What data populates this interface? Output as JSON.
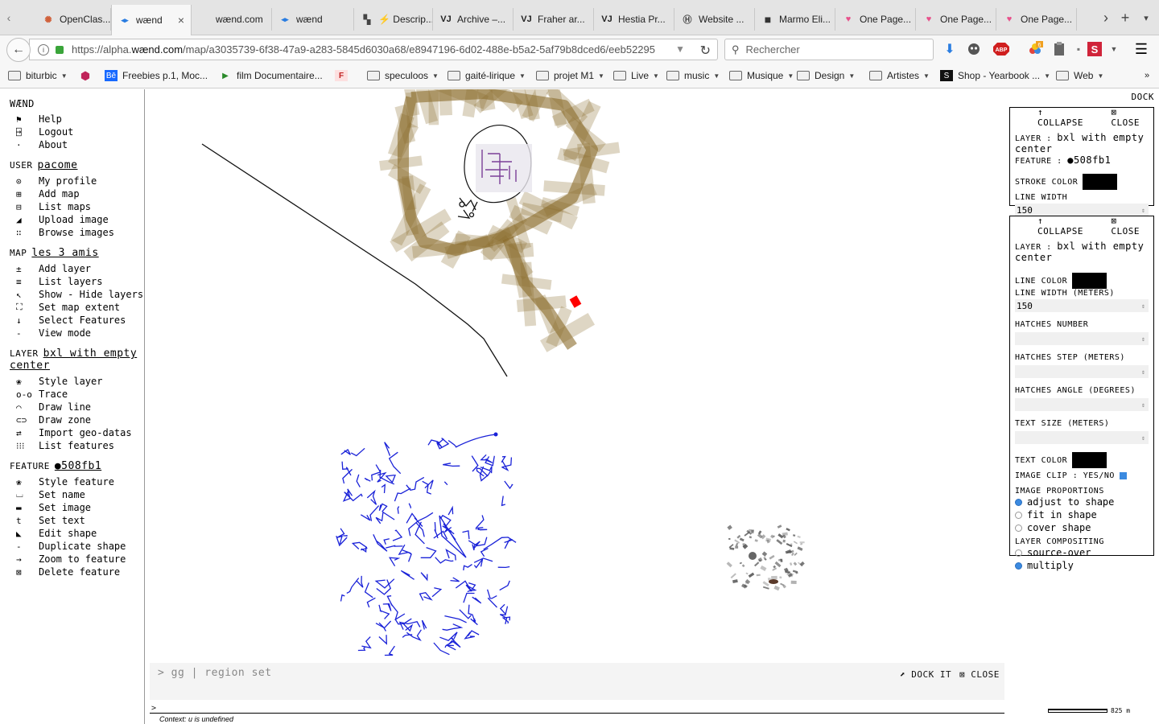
{
  "browser": {
    "tabs": [
      {
        "title": "OpenClas...",
        "icon": "openclassrooms-icon",
        "active": false
      },
      {
        "title": "wænd",
        "icon": "waend-icon",
        "active": true
      },
      {
        "title": "wænd.com",
        "icon": "",
        "active": false
      },
      {
        "title": "wænd",
        "icon": "waend-icon",
        "active": false
      },
      {
        "title": "⚡ Descrip...",
        "icon": "page-icon",
        "active": false
      },
      {
        "title": "Archive –...",
        "icon": "vj-icon",
        "active": false
      },
      {
        "title": "Fraher ar...",
        "icon": "vj-icon",
        "active": false
      },
      {
        "title": "Hestia Pr...",
        "icon": "vj-icon",
        "active": false
      },
      {
        "title": "Website ...",
        "icon": "website-icon",
        "active": false
      },
      {
        "title": "Marmo Eli...",
        "icon": "dark-square-icon",
        "active": false
      },
      {
        "title": "One Page...",
        "icon": "heart-icon",
        "active": false
      },
      {
        "title": "One Page...",
        "icon": "heart-icon",
        "active": false
      },
      {
        "title": "One Page...",
        "icon": "heart-icon",
        "active": false
      }
    ],
    "url_prefix": "https://alpha.",
    "url_domain": "wænd.com",
    "url_rest": "/map/a3035739-6f38-47a9-a283-5845d6030a68/e8947196-6d02-488e-b5a2-5af79b8dced6/eeb52295",
    "search_placeholder": "Rechercher",
    "addon_badge": "6",
    "bookmarks": [
      {
        "label": "biturbic",
        "kind": "folder"
      },
      {
        "label": "",
        "kind": "icon"
      },
      {
        "label": "Freebies p.1, Moc...",
        "kind": "behance"
      },
      {
        "label": "film Documentaire...",
        "kind": "play"
      },
      {
        "label": "",
        "kind": "f"
      },
      {
        "label": "speculoos",
        "kind": "folder"
      },
      {
        "label": "gaité-lirique",
        "kind": "folder"
      },
      {
        "label": "projet M1",
        "kind": "folder"
      },
      {
        "label": "Live",
        "kind": "folder"
      },
      {
        "label": "music",
        "kind": "folder"
      },
      {
        "label": "Musique",
        "kind": "folder"
      },
      {
        "label": "Design",
        "kind": "folder"
      },
      {
        "label": "Artistes",
        "kind": "folder"
      },
      {
        "label": "Shop - Yearbook ...",
        "kind": "shop"
      },
      {
        "label": "Web",
        "kind": "folder"
      }
    ]
  },
  "sidebar": {
    "app_name": "WÆND",
    "app_items": [
      {
        "icon": "⚑",
        "label": "Help"
      },
      {
        "icon": "⍈",
        "label": "Logout"
      },
      {
        "icon": "·",
        "label": "About"
      }
    ],
    "user_label": "USER",
    "user_name": "pacome",
    "user_items": [
      {
        "icon": "⊙",
        "label": "My profile"
      },
      {
        "icon": "⊞",
        "label": "Add map"
      },
      {
        "icon": "⊟",
        "label": "List maps"
      },
      {
        "icon": "◢",
        "label": "Upload image"
      },
      {
        "icon": "∷",
        "label": "Browse images"
      }
    ],
    "map_label": "MAP",
    "map_name": "les 3 amis",
    "map_items": [
      {
        "icon": "±",
        "label": "Add layer"
      },
      {
        "icon": "≡",
        "label": "List layers"
      },
      {
        "icon": "↖",
        "label": "Show - Hide layers"
      },
      {
        "icon": "⛶",
        "label": "Set map extent"
      },
      {
        "icon": "↓",
        "label": "Select Features"
      },
      {
        "icon": "-",
        "label": "View mode"
      }
    ],
    "layer_label": "LAYER",
    "layer_name_1": "bxl with empty",
    "layer_name_2": "center",
    "layer_items": [
      {
        "icon": "❀",
        "label": "Style layer"
      },
      {
        "icon": "o-o",
        "label": "Trace"
      },
      {
        "icon": "⌒",
        "label": "Draw line"
      },
      {
        "icon": "⊂⊃",
        "label": "Draw zone"
      },
      {
        "icon": "⇄",
        "label": "Import geo-datas"
      },
      {
        "icon": "⁝⁝⁝",
        "label": "List features"
      }
    ],
    "feature_label": "FEATURE",
    "feature_name": "●508fb1",
    "feature_items": [
      {
        "icon": "❀",
        "label": "Style feature"
      },
      {
        "icon": "⌴",
        "label": "Set name"
      },
      {
        "icon": "▬",
        "label": "Set image"
      },
      {
        "icon": "t",
        "label": "Set text"
      },
      {
        "icon": "◣",
        "label": "Edit shape"
      },
      {
        "icon": "-",
        "label": "Duplicate shape"
      },
      {
        "icon": "→",
        "label": "Zoom to feature"
      },
      {
        "icon": "⊠",
        "label": "Delete feature"
      }
    ]
  },
  "dock_label": "DOCK",
  "panel_feature": {
    "collapse": "COLLAPSE",
    "close": "CLOSE",
    "layer_label": "LAYER :",
    "layer_value": "bxl with empty center",
    "feature_label": "FEATURE :",
    "feature_value": "●508fb1",
    "stroke_color_label": "STROKE COLOR",
    "stroke_color": "#000000",
    "line_width_label": "LINE WIDTH",
    "line_width": "150"
  },
  "panel_layer": {
    "collapse": "COLLAPSE",
    "close": "CLOSE",
    "layer_label": "LAYER :",
    "layer_value": "bxl with empty center",
    "line_color_label": "LINE COLOR",
    "line_color": "#000000",
    "line_width_label": "LINE WIDTH (METERS)",
    "line_width": "150",
    "hatches_number_label": "HATCHES NUMBER",
    "hatches_step_label": "HATCHES STEP (METERS)",
    "hatches_angle_label": "HATCHES ANGLE (DEGREES)",
    "text_size_label": "TEXT SIZE (METERS)",
    "text_color_label": "TEXT COLOR",
    "text_color": "#000000",
    "image_clip_label": "IMAGE CLIP : YES/NO",
    "image_clip": true,
    "proportions_label": "IMAGE PROPORTIONS",
    "proportions": [
      {
        "label": "adjust to shape",
        "checked": true
      },
      {
        "label": "fit in shape",
        "checked": false
      },
      {
        "label": "cover shape",
        "checked": false
      }
    ],
    "compositing_label": "LAYER COMPOSITING",
    "compositing": [
      {
        "label": "source-over",
        "checked": false
      },
      {
        "label": "multiply",
        "checked": true
      }
    ]
  },
  "console": {
    "prompt": "> gg | region set",
    "dock_it": "DOCK IT",
    "close": "CLOSE",
    "input_prompt": ">",
    "status": "Context: u is undefined"
  },
  "scale_label": "825 m",
  "colors": {
    "ring": "#8a6a2a",
    "blue_lines": "#1a22d8",
    "accent_red": "#ff0000"
  }
}
